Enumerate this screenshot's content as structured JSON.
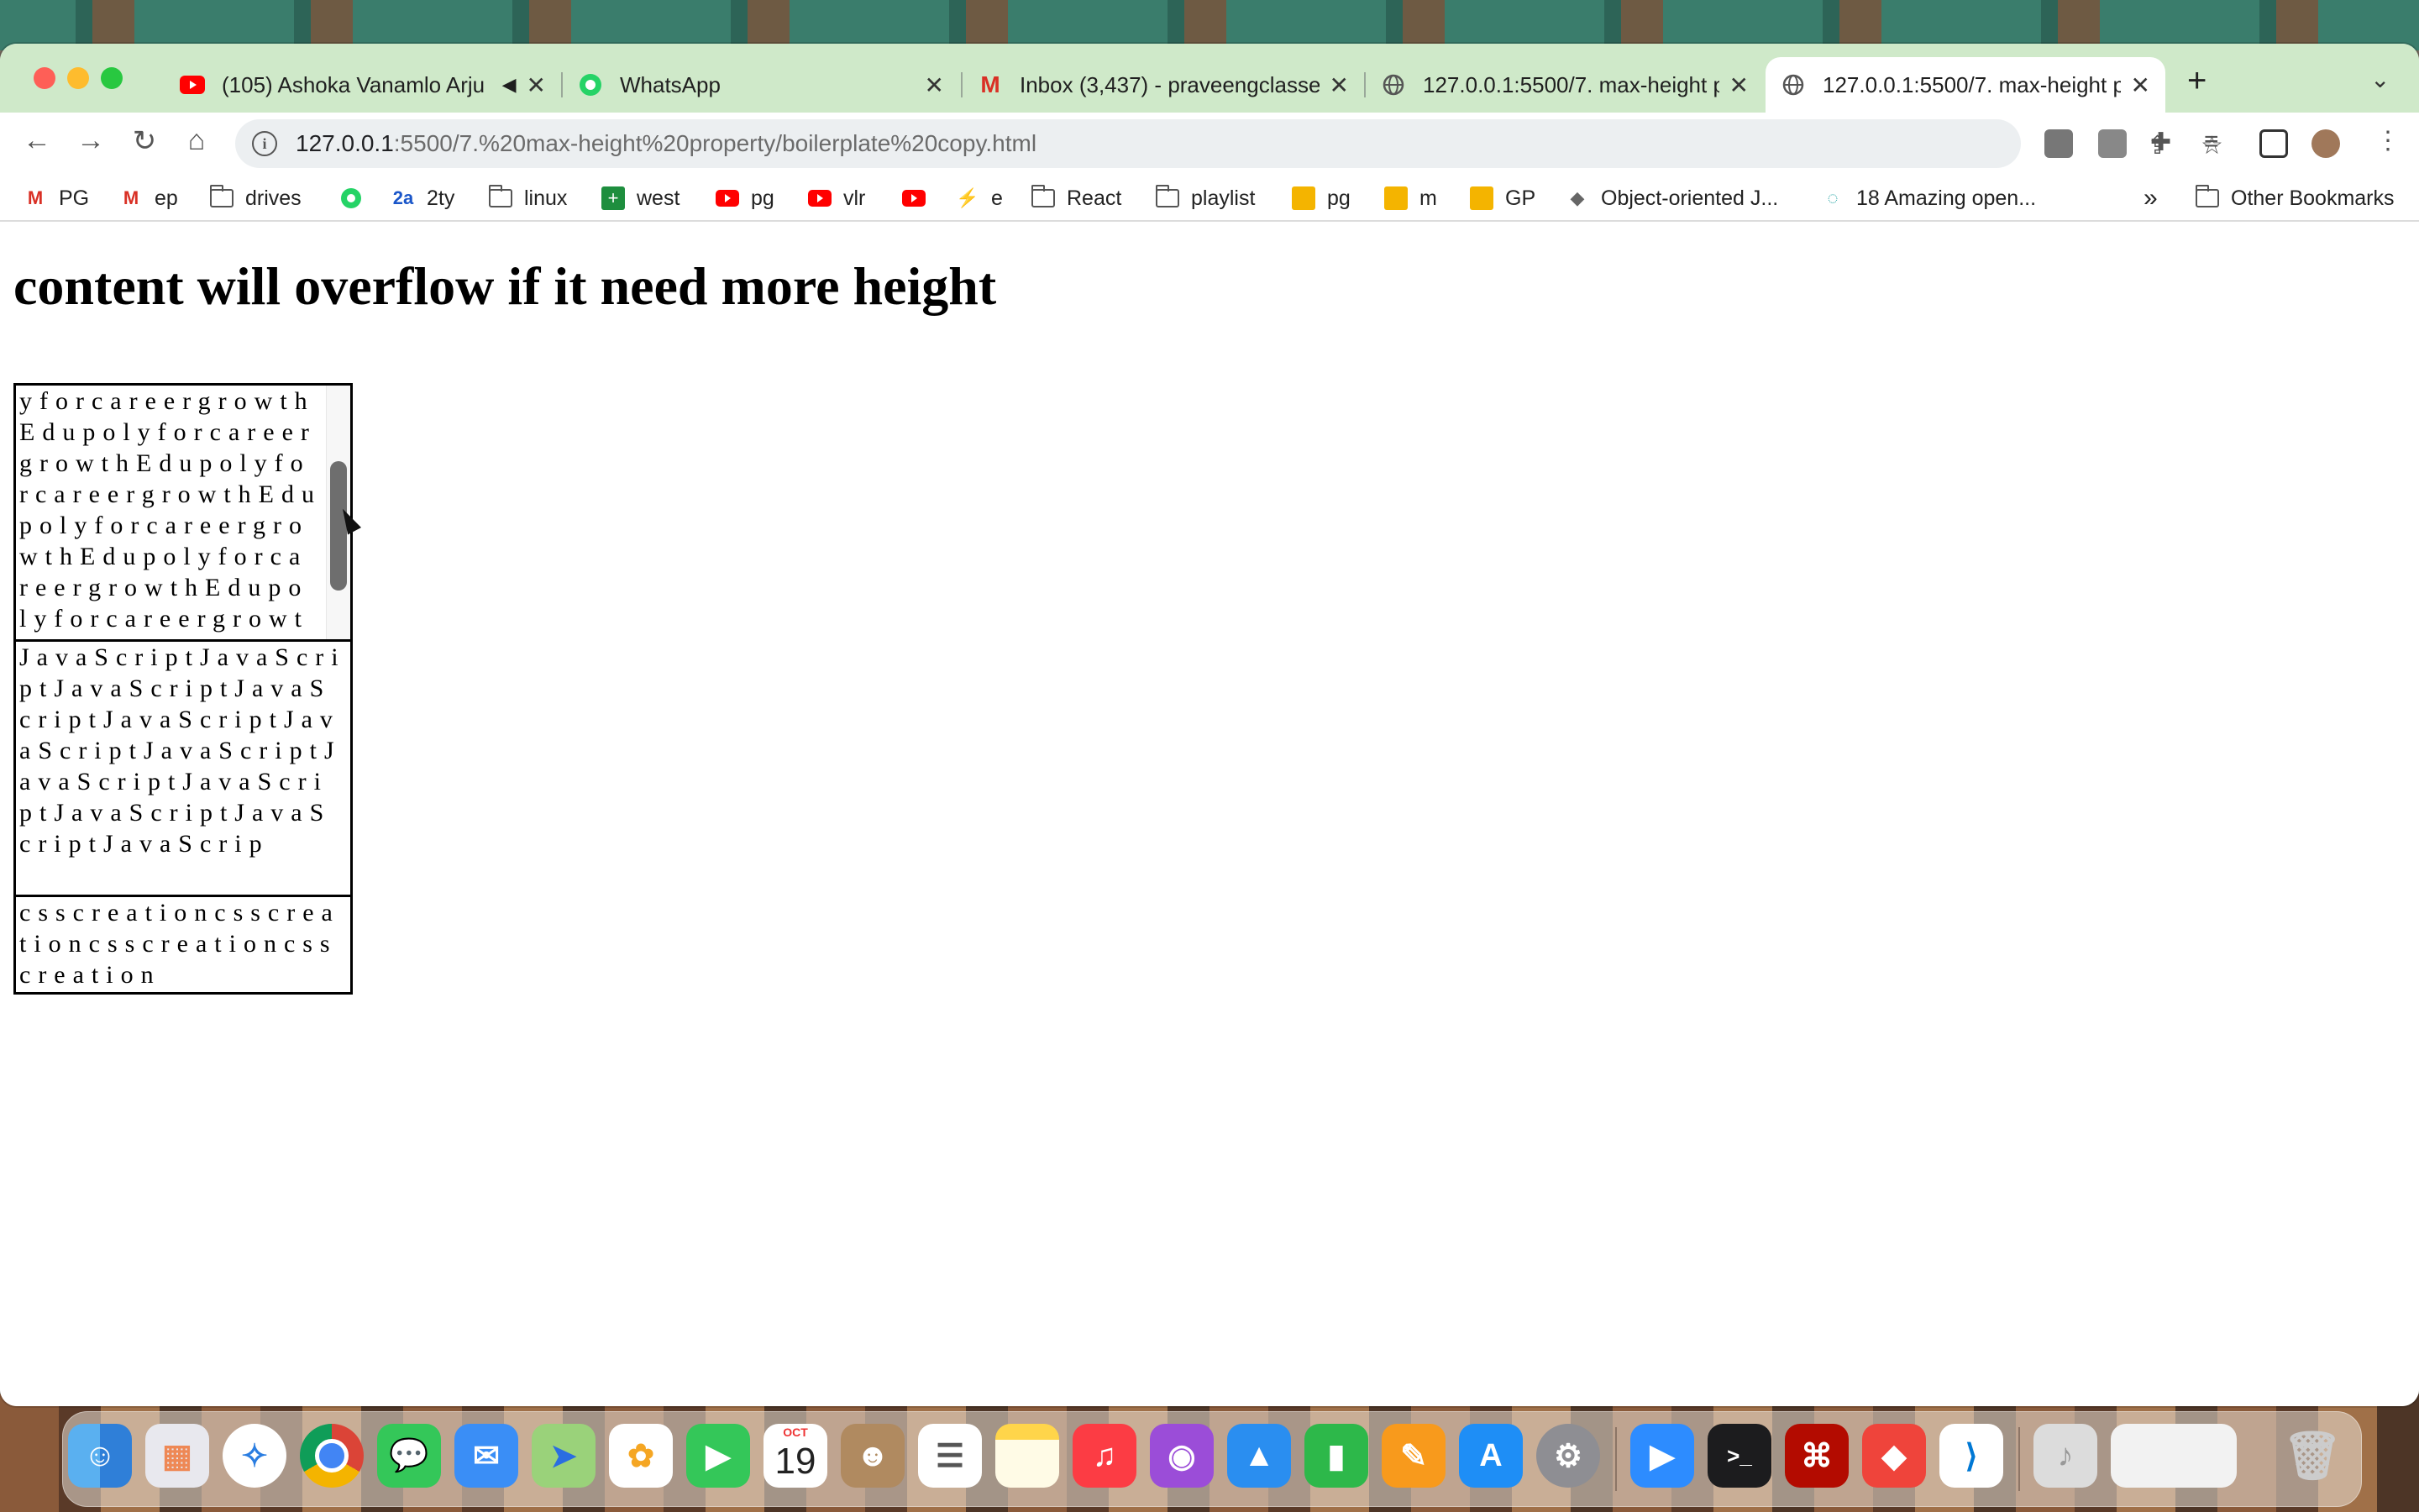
{
  "browser": {
    "tabs": [
      {
        "title": "(105) Ashoka Vanamlo Arju",
        "icon": "youtube-icon",
        "audio": true
      },
      {
        "title": "WhatsApp",
        "icon": "whatsapp-icon"
      },
      {
        "title": "Inbox (3,437) - praveengclasse",
        "icon": "gmail-icon"
      },
      {
        "title": "127.0.0.1:5500/7. max-height p",
        "icon": "globe-icon"
      },
      {
        "title": "127.0.0.1:5500/7. max-height p",
        "icon": "globe-icon",
        "active": true
      }
    ],
    "new_tab_glyph": "+",
    "tab_menu_glyph": "⌄",
    "url_host": "127.0.0.1",
    "url_path": ":5500/7.%20max-height%20property/boilerplate%20copy.html",
    "bookmarks": [
      {
        "label": "PG",
        "icon": "gmail-icon"
      },
      {
        "label": "ep",
        "icon": "gmail-icon"
      },
      {
        "label": "drives",
        "icon": "folder-icon"
      },
      {
        "label": "",
        "icon": "whatsapp-icon"
      },
      {
        "label": "2ty",
        "icon": "2a-icon",
        "icon_text": "2a"
      },
      {
        "label": "linux",
        "icon": "folder-icon"
      },
      {
        "label": "west",
        "icon": "plus-square-icon"
      },
      {
        "label": "pg",
        "icon": "youtube-icon"
      },
      {
        "label": "vlr",
        "icon": "youtube-icon"
      },
      {
        "label": "",
        "icon": "youtube-icon"
      },
      {
        "label": "e",
        "icon": "bolt-icon"
      },
      {
        "label": "React",
        "icon": "folder-icon"
      },
      {
        "label": "playlist",
        "icon": "folder-icon"
      },
      {
        "label": "pg",
        "icon": "classroom-icon"
      },
      {
        "label": "m",
        "icon": "classroom-icon"
      },
      {
        "label": "GP",
        "icon": "classroom-icon"
      },
      {
        "label": "Object-oriented J...",
        "icon": "bird-icon"
      },
      {
        "label": "18 Amazing open...",
        "icon": "loading-icon"
      }
    ],
    "bookmarks_overflow": "»",
    "other_bookmarks": "Other Bookmarks"
  },
  "page": {
    "heading": "content will overflow if it need more height",
    "box1_text": "yforcareergrowthEdupolyforcareergrowthEdupolyforcareergrowthEdupolyforcareergrowthEdupolyforcareergrowthEdupolyforcareergrowthEdupolyforcareergrowthEdupolyforcareergrowthEdupoly",
    "box2_text": "JavaScriptJavaScriptJavaScriptJavaScriptJavaScriptJavaScriptJavaScriptJavaScriptJavaScriptJavaScriptJavaScriptJavaScrip",
    "box3_text": "csscreationcsscreationcsscreationcsscreation"
  },
  "dock": {
    "calendar_month": "OCT",
    "calendar_day": "19",
    "apps": [
      "finder-icon",
      "launchpad-icon",
      "safari-icon",
      "chrome-icon",
      "messages-icon",
      "mail-icon",
      "maps-icon",
      "photos-icon",
      "facetime-icon",
      "calendar-icon",
      "contacts-icon",
      "reminders-icon",
      "notes-icon",
      "music-icon",
      "podcasts-icon",
      "keynote-icon",
      "numbers-icon",
      "pages-icon",
      "app-store-icon",
      "system-settings-icon",
      "zoom-icon",
      "terminal-icon",
      "acrobat-icon",
      "anydesk-icon",
      "vscode-icon",
      "music-file-icon",
      "downloads-stack-icon",
      "trash-icon"
    ]
  },
  "colors": {
    "tab_strip": "#cfe9c9",
    "youtube": "#ff0000",
    "whatsapp": "#25d366",
    "gmail": "#d93025"
  }
}
